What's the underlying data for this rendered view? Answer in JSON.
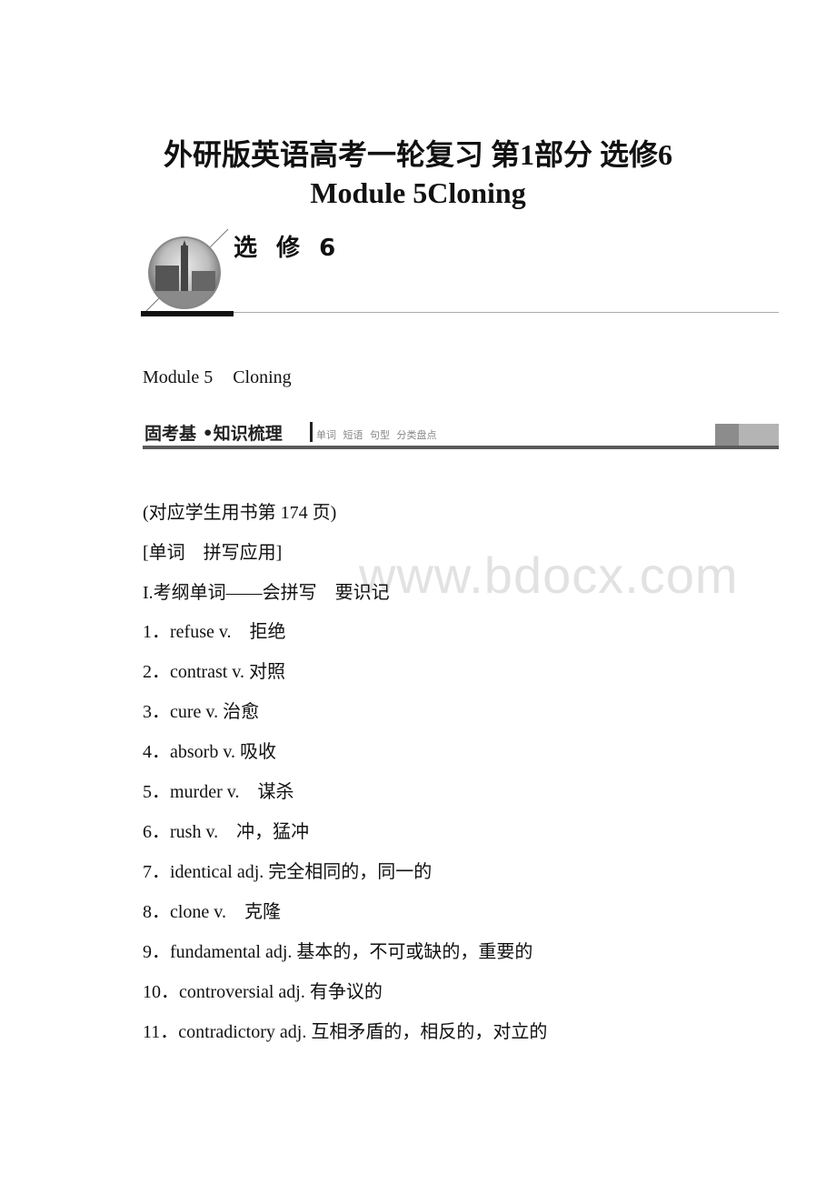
{
  "document": {
    "title_line1": "外研版英语高考一轮复习 第1部分 选修6",
    "title_line2": "Module 5Cloning",
    "banner": {
      "label": "选 修 6",
      "image_icon": "big-ben-photo"
    },
    "module_heading": {
      "module": "Module 5",
      "topic": "Cloning"
    },
    "section_bar": {
      "title": "固考基 •知识梳理",
      "subtitles": "单词 短语 句型 分类盘点"
    },
    "page_ref": "(对应学生用书第 174 页)",
    "category": "[单词　拼写应用]",
    "subsection": "I.考纲单词——会拼写　要识记",
    "watermark": "www.bdocx.com",
    "vocab": [
      {
        "num": "1．",
        "text": "refuse v.　拒绝"
      },
      {
        "num": "2．",
        "text": "contrast v. 对照"
      },
      {
        "num": "3．",
        "text": "cure v. 治愈"
      },
      {
        "num": "4．",
        "text": "absorb v. 吸收"
      },
      {
        "num": "5．",
        "text": "murder v.　谋杀"
      },
      {
        "num": "6．",
        "text": "rush v.　冲，猛冲"
      },
      {
        "num": "7．",
        "text": "identical adj. 完全相同的，同一的"
      },
      {
        "num": "8．",
        "text": "clone v.　克隆"
      },
      {
        "num": "9．",
        "text": "fundamental adj. 基本的，不可或缺的，重要的"
      },
      {
        "num": "10．",
        "text": "controversial adj. 有争议的"
      },
      {
        "num": "11．",
        "text": "contradictory adj. 互相矛盾的，相反的，对立的"
      }
    ]
  }
}
